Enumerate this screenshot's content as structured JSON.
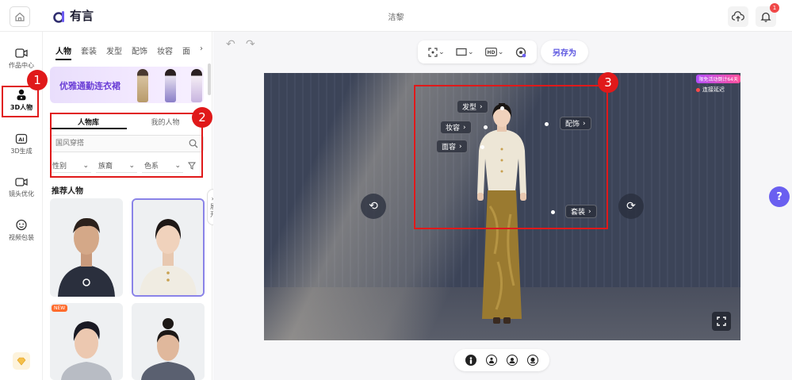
{
  "header": {
    "logo_text": "有言",
    "document_title": "洁黎",
    "notification_count": "1"
  },
  "left_nav": {
    "items": [
      {
        "label": "作品中心"
      },
      {
        "label": "3D人物"
      },
      {
        "label": "3D生成"
      },
      {
        "label": "镜头优化"
      },
      {
        "label": "视频包装"
      }
    ]
  },
  "panel": {
    "tabs": [
      "人物",
      "套装",
      "发型",
      "配饰",
      "妆容",
      "面"
    ],
    "tabs_more": "›",
    "banner_text": "优雅通勤连衣裙",
    "subtabs": [
      "人物库",
      "我的人物"
    ],
    "search_placeholder": "国风穿搭",
    "filters": [
      "性别",
      "族裔",
      "色系"
    ],
    "section_title": "推荐人物",
    "new_tag": "NEW",
    "collapse_label_1": "»",
    "collapse_label_2": "展",
    "collapse_label_3": "开"
  },
  "toolbar": {
    "save_as": "另存为",
    "hd_label": "HD"
  },
  "viewport": {
    "hotspots": {
      "hair": "发型",
      "makeup": "妆容",
      "accessory": "配饰",
      "face": "面容",
      "outfit": "套装"
    },
    "promo": "限免活动倒计64天",
    "delay_label": "连接延迟"
  },
  "annotations": {
    "marker_1": "1",
    "marker_2": "2",
    "marker_3": "3"
  },
  "help_label": "?",
  "colors": {
    "accent": "#5b55e0",
    "annotation_red": "#e0191a",
    "selected_border": "#8a83e8"
  }
}
